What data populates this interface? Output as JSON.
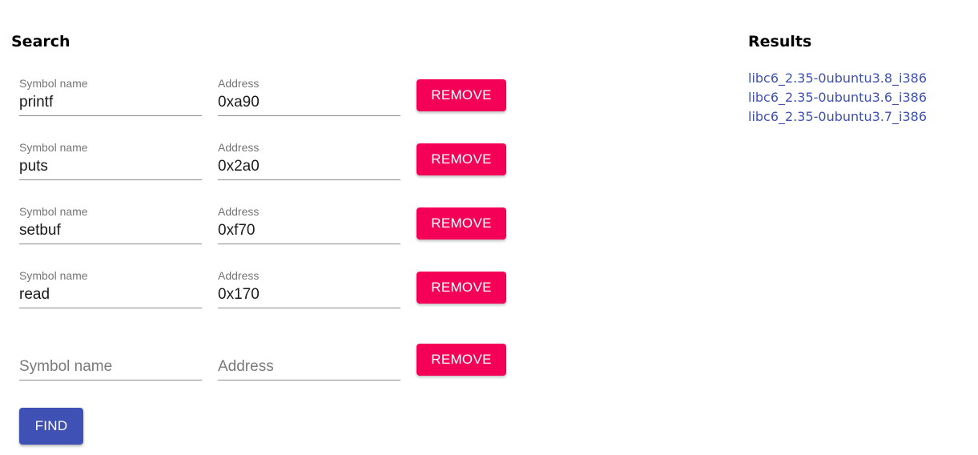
{
  "search": {
    "title": "Search",
    "rows": [
      {
        "symbol_label": "Symbol name",
        "symbol_value": "printf",
        "address_label": "Address",
        "address_value": "0xa90",
        "remove_label": "REMOVE"
      },
      {
        "symbol_label": "Symbol name",
        "symbol_value": "puts",
        "address_label": "Address",
        "address_value": "0x2a0",
        "remove_label": "REMOVE"
      },
      {
        "symbol_label": "Symbol name",
        "symbol_value": "setbuf",
        "address_label": "Address",
        "address_value": "0xf70",
        "remove_label": "REMOVE"
      },
      {
        "symbol_label": "Symbol name",
        "symbol_value": "read",
        "address_label": "Address",
        "address_value": "0x170",
        "remove_label": "REMOVE"
      }
    ],
    "empty_row": {
      "symbol_placeholder": "Symbol name",
      "address_placeholder": "Address",
      "remove_label": "REMOVE"
    },
    "find_label": "FIND"
  },
  "results": {
    "title": "Results",
    "items": [
      "libc6_2.35-0ubuntu3.8_i386",
      "libc6_2.35-0ubuntu3.6_i386",
      "libc6_2.35-0ubuntu3.7_i386"
    ]
  },
  "colors": {
    "remove_button": "#f50057",
    "find_button": "#3f51b5",
    "link": "#3f51b5"
  }
}
